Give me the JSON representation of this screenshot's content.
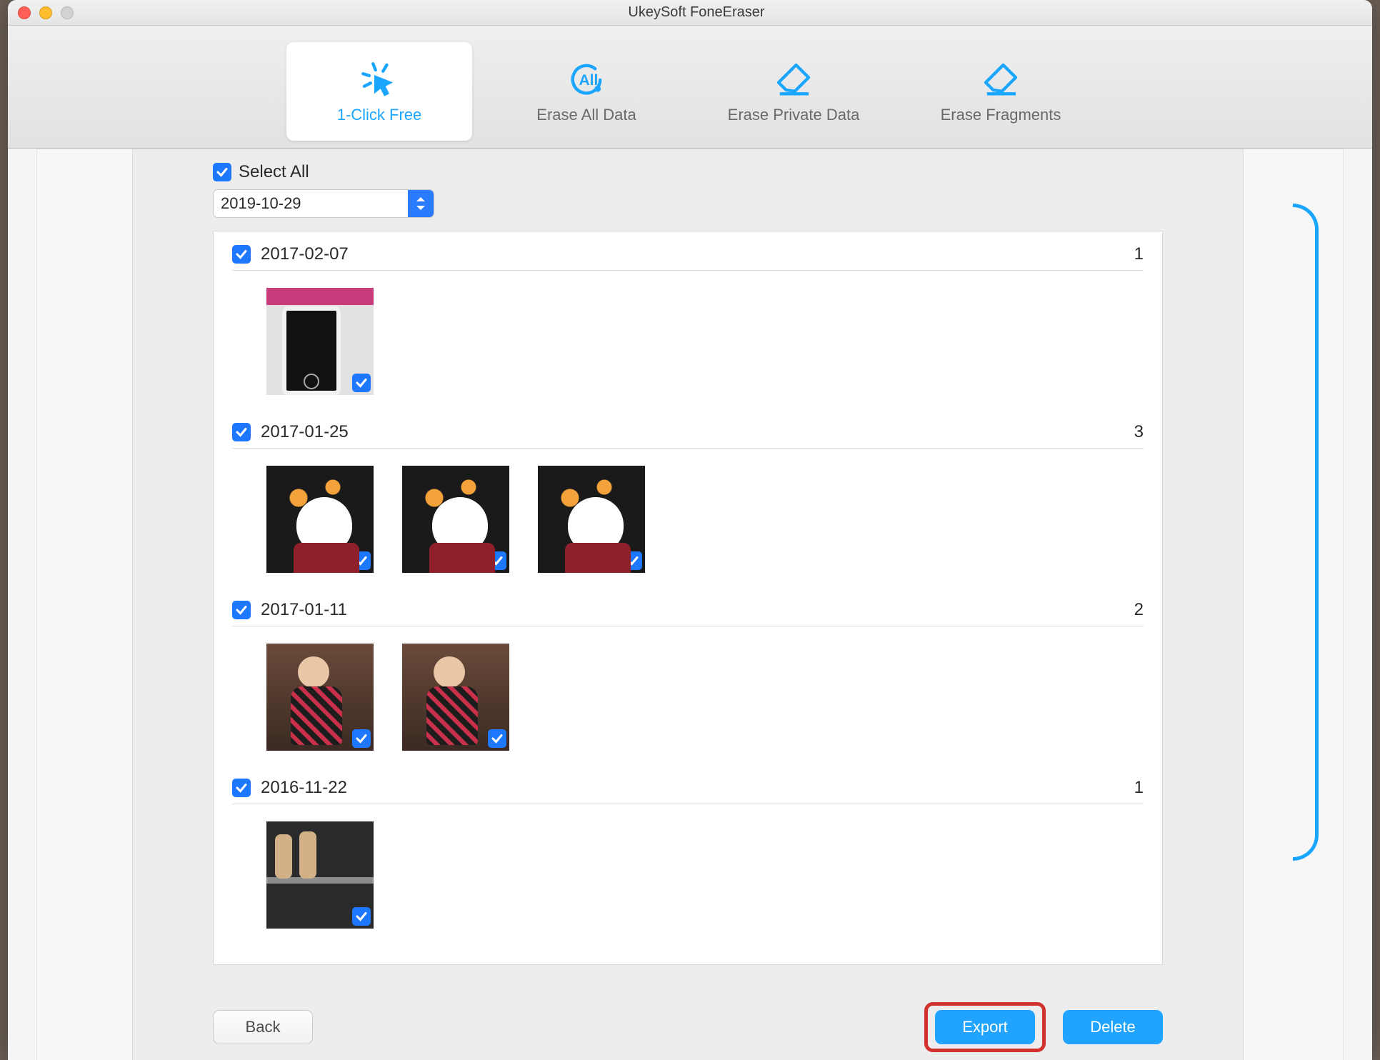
{
  "window": {
    "title": "UkeySoft FoneEraser"
  },
  "tabs": [
    {
      "label": "1-Click Free",
      "icon": "cursor-click-icon",
      "active": true
    },
    {
      "label": "Erase All Data",
      "icon": "all-icon",
      "active": false
    },
    {
      "label": "Erase Private Data",
      "icon": "eraser-icon",
      "active": false
    },
    {
      "label": "Erase Fragments",
      "icon": "eraser-icon",
      "active": false
    }
  ],
  "select_all_label": "Select All",
  "date_filter": "2019-10-29",
  "groups": [
    {
      "date": "2017-02-07",
      "count": 1,
      "thumbs": [
        "phone"
      ]
    },
    {
      "date": "2017-01-25",
      "count": 3,
      "thumbs": [
        "cat",
        "cat",
        "cat"
      ]
    },
    {
      "date": "2017-01-11",
      "count": 2,
      "thumbs": [
        "girl",
        "girl"
      ]
    },
    {
      "date": "2016-11-22",
      "count": 1,
      "thumbs": [
        "street"
      ]
    }
  ],
  "buttons": {
    "back": "Back",
    "export": "Export",
    "delete": "Delete"
  }
}
